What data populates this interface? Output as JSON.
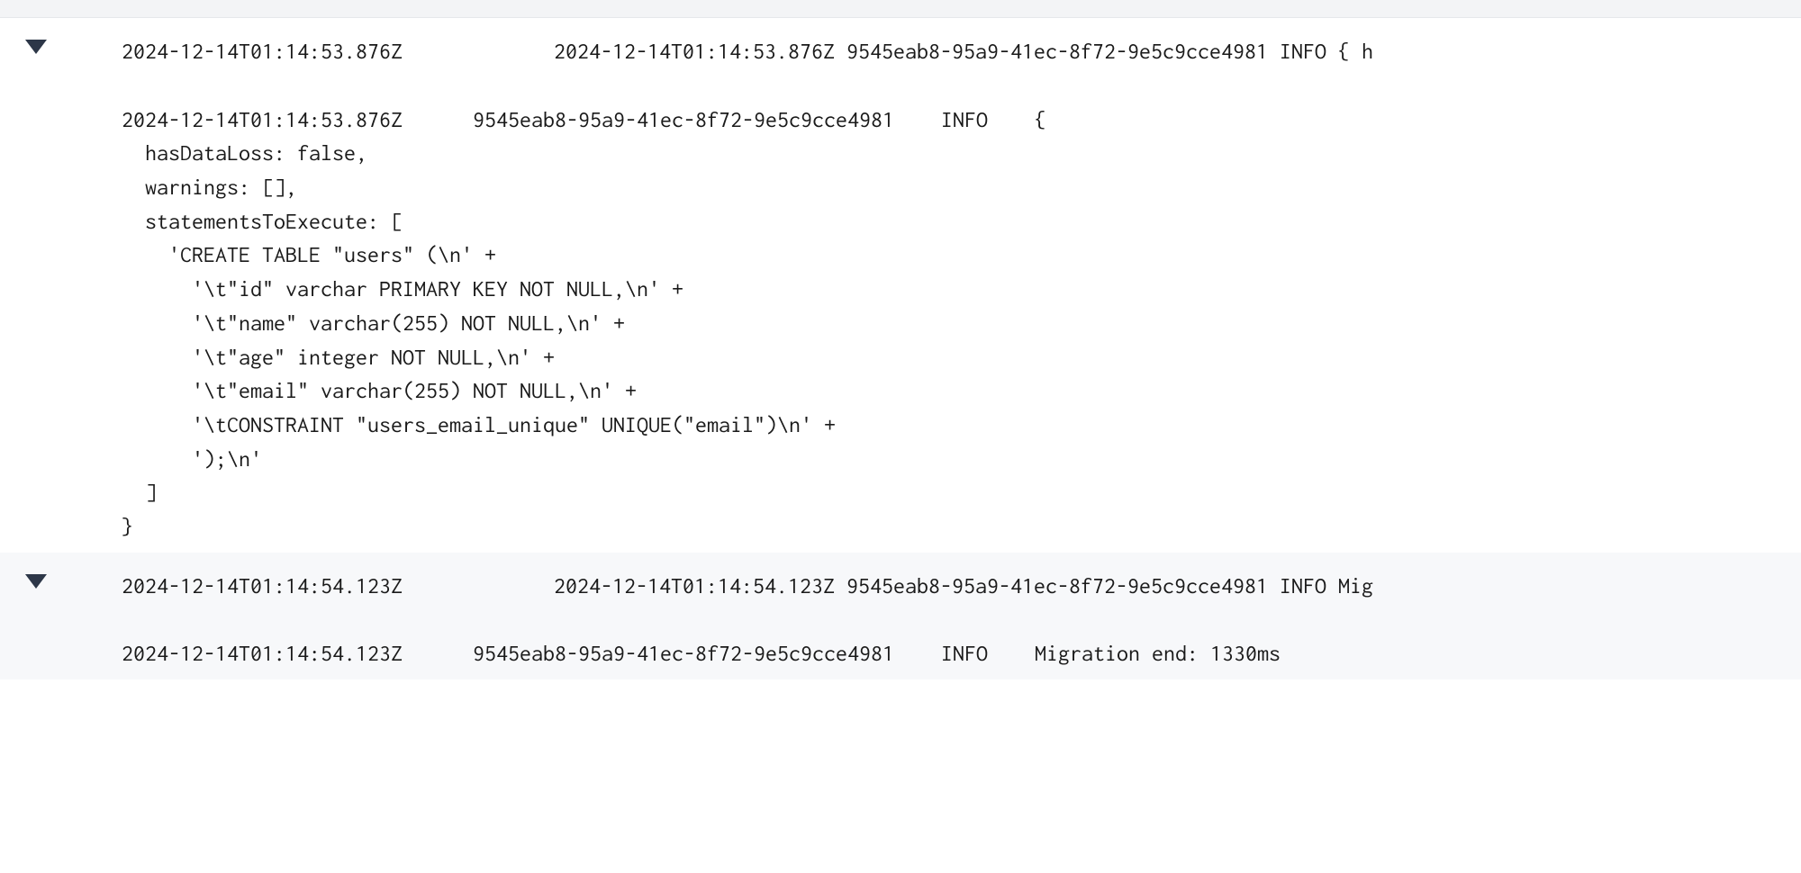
{
  "entries": [
    {
      "summary_ts": "2024-12-14T01:14:53.876Z",
      "summary_msg": "2024-12-14T01:14:53.876Z 9545eab8-95a9-41ec-8f72-9e5c9cce4981 INFO { h",
      "detail_header": "2024-12-14T01:14:53.876Z      9545eab8-95a9-41ec-8f72-9e5c9cce4981    INFO    {",
      "detail_body": "  hasDataLoss: false,\n  warnings: [],\n  statementsToExecute: [\n    'CREATE TABLE \"users\" (\\n' +\n      '\\t\"id\" varchar PRIMARY KEY NOT NULL,\\n' +\n      '\\t\"name\" varchar(255) NOT NULL,\\n' +\n      '\\t\"age\" integer NOT NULL,\\n' +\n      '\\t\"email\" varchar(255) NOT NULL,\\n' +\n      '\\tCONSTRAINT \"users_email_unique\" UNIQUE(\"email\")\\n' +\n      ');\\n'\n  ]\n}"
    },
    {
      "summary_ts": "2024-12-14T01:14:54.123Z",
      "summary_msg": "2024-12-14T01:14:54.123Z 9545eab8-95a9-41ec-8f72-9e5c9cce4981 INFO Mig",
      "detail_header": "2024-12-14T01:14:54.123Z      9545eab8-95a9-41ec-8f72-9e5c9cce4981    INFO    Migration end: 1330ms",
      "detail_body": ""
    }
  ]
}
